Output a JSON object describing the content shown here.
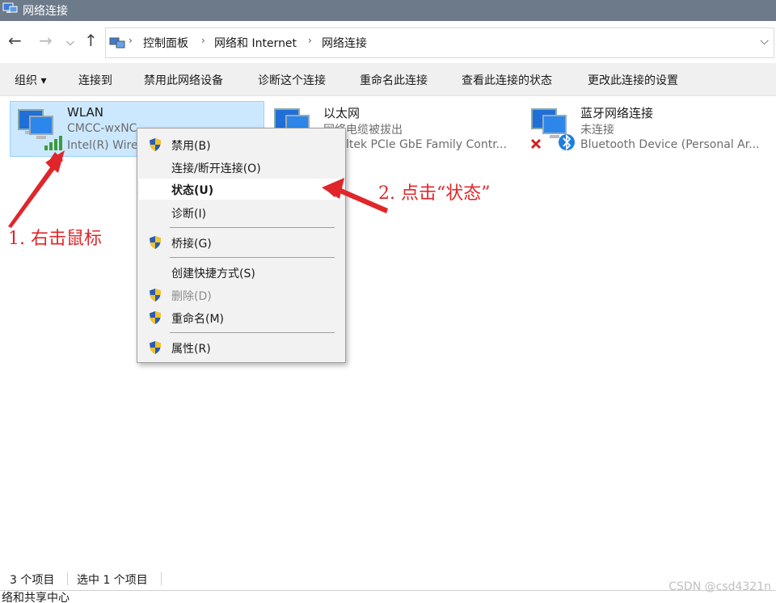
{
  "window": {
    "title": "网络连接"
  },
  "address": {
    "crumbs": [
      "控制面板",
      "网络和 Internet",
      "网络连接"
    ]
  },
  "toolbar": {
    "items": [
      "组织 ▾",
      "连接到",
      "禁用此网络设备",
      "诊断这个连接",
      "重命名此连接",
      "查看此连接的状态",
      "更改此连接的设置"
    ]
  },
  "connections": [
    {
      "name": "WLAN",
      "line1": "CMCC-wxNC",
      "line2": "Intel(R) Wire",
      "icon": "wifi-adapter-icon"
    },
    {
      "name": "以太网",
      "line1": "网络电缆被拔出",
      "line2": "ltek PCIe GbE Family Contr...",
      "icon": "ethernet-adapter-icon"
    },
    {
      "name": "蓝牙网络连接",
      "line1": "未连接",
      "line2": "Bluetooth Device (Personal Ar...",
      "icon": "bluetooth-adapter-icon"
    }
  ],
  "context_menu": {
    "items": [
      {
        "label": "禁用(B)",
        "shield": true,
        "state": "normal"
      },
      {
        "label": "连接/断开连接(O)",
        "shield": false,
        "state": "normal"
      },
      {
        "label": "状态(U)",
        "shield": false,
        "state": "highlighted"
      },
      {
        "label": "诊断(I)",
        "shield": false,
        "state": "normal"
      },
      {
        "label": "桥接(G)",
        "shield": true,
        "state": "normal"
      },
      {
        "label": "创建快捷方式(S)",
        "shield": false,
        "state": "normal"
      },
      {
        "label": "删除(D)",
        "shield": true,
        "state": "disabled"
      },
      {
        "label": "重命名(M)",
        "shield": true,
        "state": "normal"
      },
      {
        "label": "属性(R)",
        "shield": true,
        "state": "normal"
      }
    ]
  },
  "annotations": {
    "step1": "1. 右击鼠标",
    "step2": "2. 点击“状态”",
    "color": "#e0262a"
  },
  "status_bar": {
    "count": "3 个项目",
    "selected": "选中 1 个项目",
    "bottom_text": "络和共享中心"
  },
  "watermark": "CSDN @csd4321n",
  "colors": {
    "selection": "#cce8ff",
    "titlebar": "#6d7a8a",
    "toolbar_bg": "#f0f0f0"
  }
}
